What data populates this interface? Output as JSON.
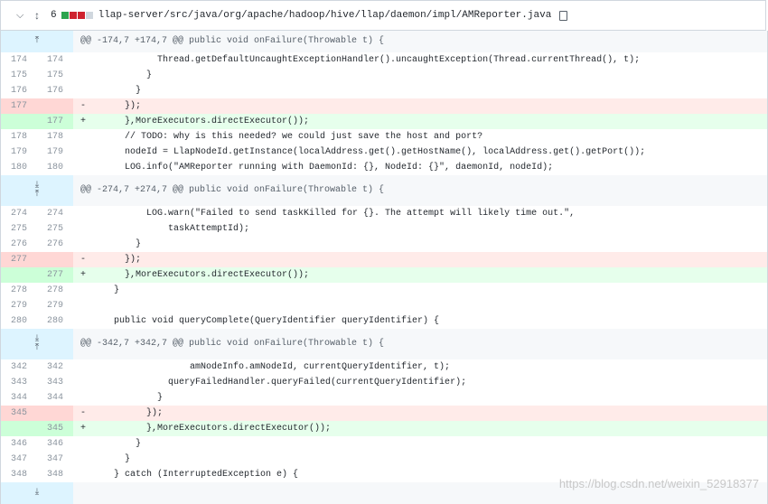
{
  "file": {
    "change_count": "6",
    "path": "llap-server/src/java/org/apache/hadoop/hive/llap/daemon/impl/AMReporter.java",
    "colors": {
      "add": "#2da44e",
      "del": "#cf222e",
      "neutral": "#d0d7de"
    }
  },
  "hunks": [
    {
      "header": "@@ -174,7 +174,7 @@ public void onFailure(Throwable t) {",
      "lines": [
        {
          "type": "ctx",
          "old": "174",
          "new": "174",
          "sign": "",
          "code": "          Thread.getDefaultUncaughtExceptionHandler().uncaughtException(Thread.currentThread(), t);"
        },
        {
          "type": "ctx",
          "old": "175",
          "new": "175",
          "sign": "",
          "code": "        }"
        },
        {
          "type": "ctx",
          "old": "176",
          "new": "176",
          "sign": "",
          "code": "      }"
        },
        {
          "type": "del",
          "old": "177",
          "new": "",
          "sign": "-",
          "code": "    });"
        },
        {
          "type": "add",
          "old": "",
          "new": "177",
          "sign": "+",
          "code": "    },MoreExecutors.directExecutor());"
        },
        {
          "type": "ctx",
          "old": "178",
          "new": "178",
          "sign": "",
          "code": "    // TODO: why is this needed? we could just save the host and port?"
        },
        {
          "type": "ctx",
          "old": "179",
          "new": "179",
          "sign": "",
          "code": "    nodeId = LlapNodeId.getInstance(localAddress.get().getHostName(), localAddress.get().getPort());"
        },
        {
          "type": "ctx",
          "old": "180",
          "new": "180",
          "sign": "",
          "code": "    LOG.info(\"AMReporter running with DaemonId: {}, NodeId: {}\", daemonId, nodeId);"
        }
      ]
    },
    {
      "header": "@@ -274,7 +274,7 @@ public void onFailure(Throwable t) {",
      "lines": [
        {
          "type": "ctx",
          "old": "274",
          "new": "274",
          "sign": "",
          "code": "        LOG.warn(\"Failed to send taskKilled for {}. The attempt will likely time out.\","
        },
        {
          "type": "ctx",
          "old": "275",
          "new": "275",
          "sign": "",
          "code": "            taskAttemptId);"
        },
        {
          "type": "ctx",
          "old": "276",
          "new": "276",
          "sign": "",
          "code": "      }"
        },
        {
          "type": "del",
          "old": "277",
          "new": "",
          "sign": "-",
          "code": "    });"
        },
        {
          "type": "add",
          "old": "",
          "new": "277",
          "sign": "+",
          "code": "    },MoreExecutors.directExecutor());"
        },
        {
          "type": "ctx",
          "old": "278",
          "new": "278",
          "sign": "",
          "code": "  }"
        },
        {
          "type": "ctx",
          "old": "279",
          "new": "279",
          "sign": "",
          "code": ""
        },
        {
          "type": "ctx",
          "old": "280",
          "new": "280",
          "sign": "",
          "code": "  public void queryComplete(QueryIdentifier queryIdentifier) {"
        }
      ]
    },
    {
      "header": "@@ -342,7 +342,7 @@ public void onFailure(Throwable t) {",
      "lines": [
        {
          "type": "ctx",
          "old": "342",
          "new": "342",
          "sign": "",
          "code": "                amNodeInfo.amNodeId, currentQueryIdentifier, t);"
        },
        {
          "type": "ctx",
          "old": "343",
          "new": "343",
          "sign": "",
          "code": "            queryFailedHandler.queryFailed(currentQueryIdentifier);"
        },
        {
          "type": "ctx",
          "old": "344",
          "new": "344",
          "sign": "",
          "code": "          }"
        },
        {
          "type": "del",
          "old": "345",
          "new": "",
          "sign": "-",
          "code": "        });"
        },
        {
          "type": "add",
          "old": "",
          "new": "345",
          "sign": "+",
          "code": "        },MoreExecutors.directExecutor());"
        },
        {
          "type": "ctx",
          "old": "346",
          "new": "346",
          "sign": "",
          "code": "      }"
        },
        {
          "type": "ctx",
          "old": "347",
          "new": "347",
          "sign": "",
          "code": "    }"
        },
        {
          "type": "ctx",
          "old": "348",
          "new": "348",
          "sign": "",
          "code": "  } catch (InterruptedException e) {"
        }
      ]
    }
  ],
  "watermark": "https://blog.csdn.net/weixin_52918377"
}
